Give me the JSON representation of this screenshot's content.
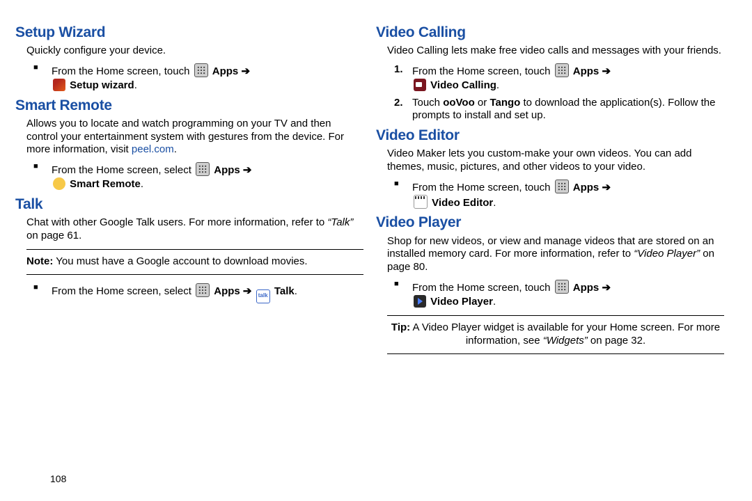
{
  "page_number": "108",
  "arrow": " ➔ ",
  "apps_label": "Apps",
  "left": {
    "setup": {
      "title": "Setup Wizard",
      "lead": "Quickly configure your device.",
      "step_prefix": "From the Home screen, touch ",
      "app_label": "Setup wizard"
    },
    "remote": {
      "title": "Smart Remote",
      "lead_a": "Allows you to locate and watch programming on your TV and then control your entertainment system with gestures from the device. For more information, visit ",
      "lead_link": "peel.com",
      "lead_b": ".",
      "step_prefix": "From the Home screen, select ",
      "app_label": "Smart Remote"
    },
    "talk": {
      "title": "Talk",
      "lead_a": "Chat with other Google Talk users. For more information, refer to ",
      "lead_ref": "“Talk”",
      "lead_b": "  on page 61.",
      "note_prefix": "Note:",
      "note_body": " You must have a Google account to download movies.",
      "step_prefix": "From the Home screen, select ",
      "talk_icon_txt": "talk",
      "app_label": "Talk"
    }
  },
  "right": {
    "vcall": {
      "title": "Video Calling",
      "lead": "Video Calling lets make free video calls and messages with your friends.",
      "step1_prefix": "From the Home screen, touch ",
      "app_label": "Video Calling",
      "step2_a": "Touch ",
      "step2_b1": "ooVoo",
      "step2_c": " or ",
      "step2_b2": "Tango",
      "step2_d": " to download the application(s). Follow the prompts to install and set up."
    },
    "vedit": {
      "title": "Video Editor",
      "lead": "Video Maker lets you custom-make your own videos. You can add themes, music, pictures, and other videos to your video.",
      "step_prefix": "From the Home screen, touch ",
      "app_label": "Video Editor"
    },
    "vplay": {
      "title": "Video Player",
      "lead_a": "Shop for new videos, or view and manage videos that are stored on an installed memory card. For more information, refer to ",
      "lead_ref": "“Video Player”",
      "lead_b": "  on page 80.",
      "step_prefix": "From the Home screen, touch ",
      "app_label": "Video Player",
      "tip_prefix": "Tip:",
      "tip_a": " A Video Player widget is available for your Home screen. For more information, see ",
      "tip_ref": "“Widgets”",
      "tip_b": " on page 32."
    }
  }
}
